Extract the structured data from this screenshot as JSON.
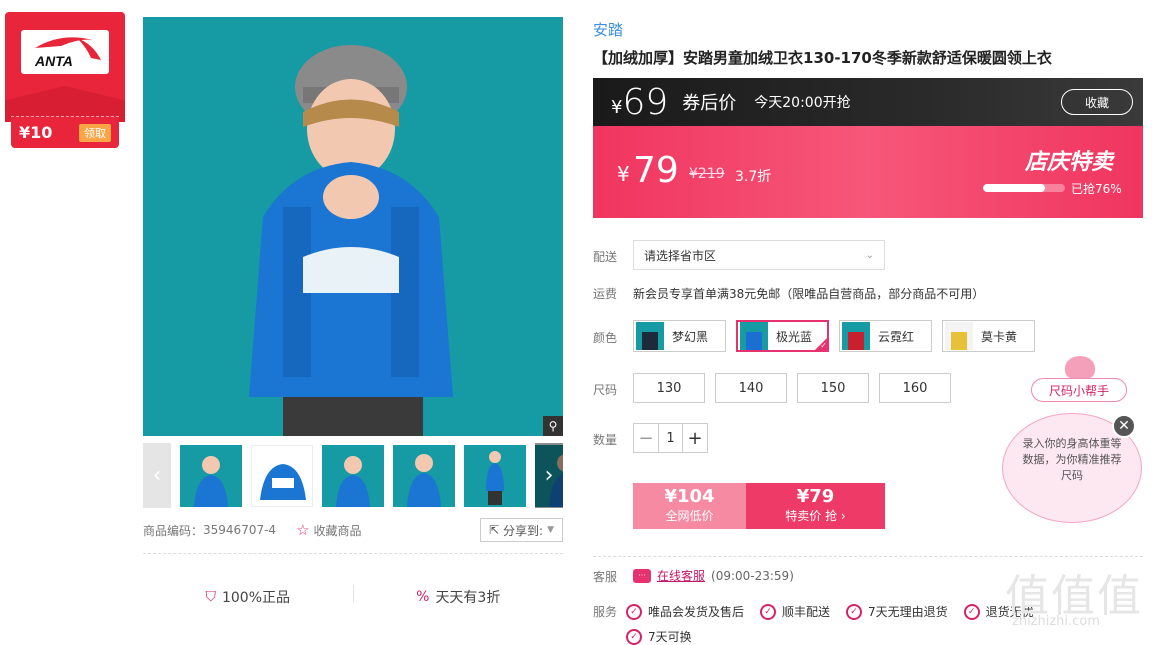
{
  "coupon": {
    "amount": "¥10",
    "claim": "领取",
    "logo_text": "ANTA"
  },
  "gallery": {
    "zoom_icon": "magnifier-icon",
    "prev_icon": "chevron-left-icon",
    "next_icon": "chevron-right-icon",
    "thumbnail_count": 6
  },
  "meta": {
    "code_label": "商品编码：",
    "code": "35946707-4",
    "favorite": "收藏商品",
    "share": "分享到:"
  },
  "guarantees": [
    {
      "label": "100%正品",
      "icon": "shield-icon"
    },
    {
      "label": "天天有3折",
      "icon": "percent-icon"
    }
  ],
  "product": {
    "brand": "安踏",
    "title": "【加绒加厚】安踏男童加绒卫衣130-170冬季新款舒适保暖圆领上衣"
  },
  "promo": {
    "coupon_yen": "¥",
    "coupon_price": "69",
    "coupon_label": "券后价",
    "start_time": "今天20:00开抢",
    "collect": "收藏",
    "yen": "¥",
    "price": "79",
    "original": "¥219",
    "discount": "3.7折",
    "event": "店庆特卖",
    "sold_percent": 76,
    "sold_label": "已抢76%",
    "colors": {
      "top_bg": "#1a1a1a",
      "main_bg": "#f0355f"
    }
  },
  "delivery": {
    "label": "配送",
    "placeholder": "请选择省市区"
  },
  "shipping": {
    "label": "运费",
    "text": "新会员专享首单满38元免邮（限唯品自营商品，部分商品不可用）"
  },
  "color": {
    "label": "颜色",
    "options": [
      {
        "name": "梦幻黑",
        "swatch": "#1c2a3a",
        "selected": false
      },
      {
        "name": "极光蓝",
        "swatch": "#1a6fd0",
        "selected": true
      },
      {
        "name": "云霓红",
        "swatch": "#c8202e",
        "selected": false
      },
      {
        "name": "莫卡黄",
        "swatch": "#e7c13a",
        "selected": false
      }
    ]
  },
  "size": {
    "label": "尺码",
    "options": [
      "130",
      "140",
      "150",
      "160"
    ]
  },
  "quantity": {
    "label": "数量",
    "value": "1",
    "minus": "−",
    "plus": "+"
  },
  "buy": {
    "market_price": "¥104",
    "market_label": "全网低价",
    "sale_price": "¥79",
    "sale_label": "特卖价 抢 ›"
  },
  "service": {
    "label": "客服",
    "link": "在线客服",
    "hours": "(09:00-23:59)"
  },
  "services": {
    "label": "服务",
    "items": [
      "唯品会发货及售后",
      "顺丰配送",
      "7天无理由退货",
      "退货无忧",
      "7天可换"
    ]
  },
  "size_helper": {
    "tag": "尺码小帮手",
    "text": "录入你的身高体重等数据，为你精准推荐尺码",
    "close_icon": "close-icon"
  },
  "watermark": {
    "title": "值值值",
    "url": "zhizhizhi.com"
  }
}
